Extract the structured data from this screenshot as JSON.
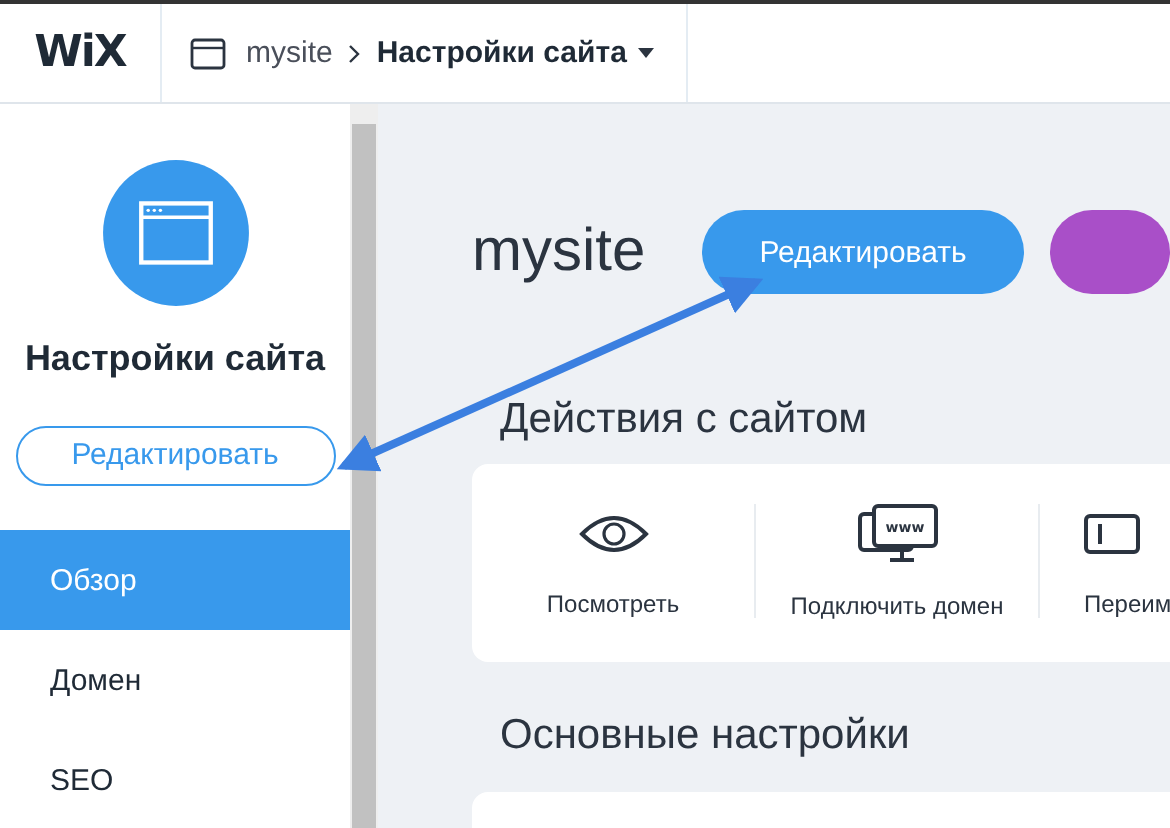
{
  "header": {
    "logo": "WiX",
    "breadcrumb": [
      {
        "label": "mysite",
        "kind": "link"
      },
      {
        "label": "Настройки сайта",
        "kind": "menu"
      }
    ]
  },
  "sidebar": {
    "title": "Настройки сайта",
    "edit_button": "Редактировать",
    "items": [
      {
        "label": "Обзор",
        "selected": true
      },
      {
        "label": "Домен",
        "selected": false
      },
      {
        "label": "SEO",
        "selected": false
      }
    ]
  },
  "main": {
    "site_name": "mysite",
    "edit_button": "Редактировать",
    "actions_heading": "Действия с сайтом",
    "actions": [
      {
        "label": "Посмотреть",
        "kind": "eye"
      },
      {
        "label": "Подключить домен",
        "kind": "www"
      },
      {
        "label": "Переим",
        "kind": "rename"
      }
    ],
    "settings_heading": "Основные настройки"
  }
}
